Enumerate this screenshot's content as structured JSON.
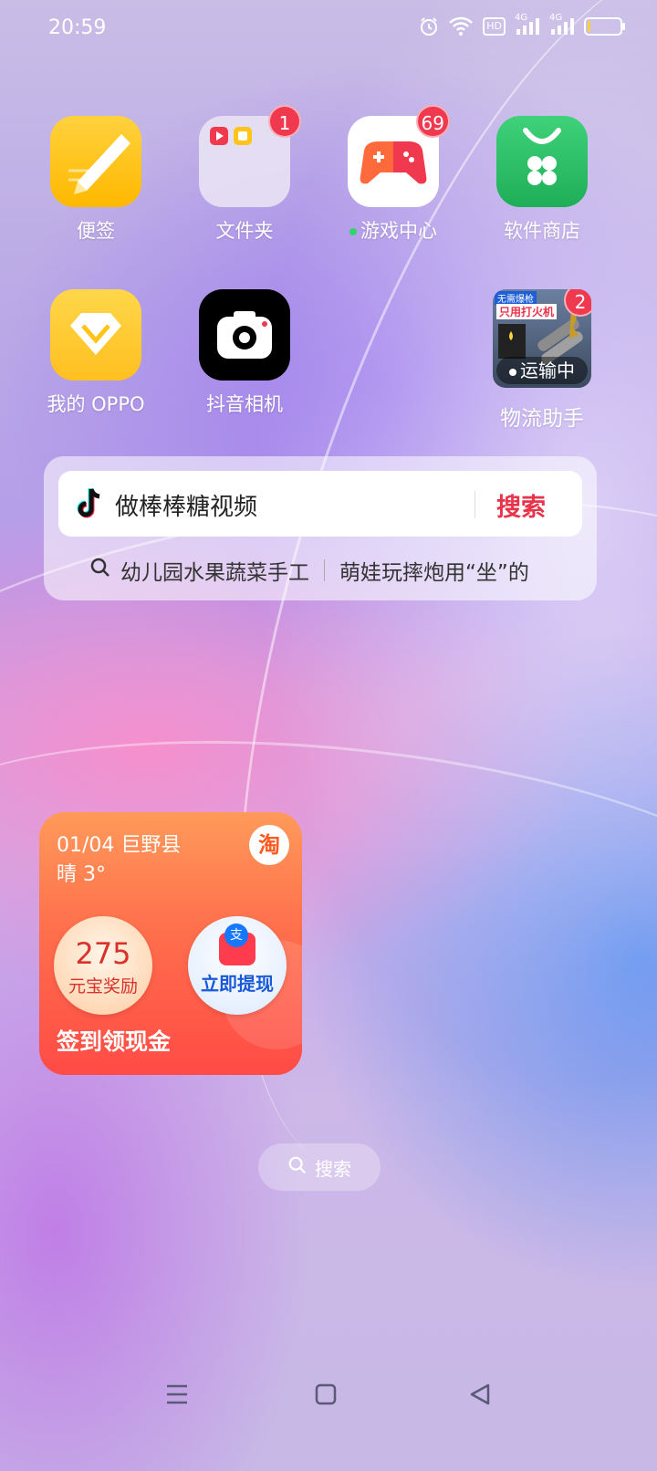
{
  "status_bar": {
    "time": "20:59",
    "icons": [
      "alarm-icon",
      "wifi-icon",
      "hd-icon",
      "signal-4g-icon",
      "signal-4g-icon",
      "battery-icon"
    ],
    "hd_label": "HD",
    "net_label_1": "4G",
    "net_label_2": "4G",
    "battery_level": 0.1,
    "battery_color": "#f7d23a"
  },
  "apps": [
    {
      "label": "便签",
      "icon": "notes-icon"
    },
    {
      "label": "文件夹",
      "icon": "folder-icon",
      "badge": "1"
    },
    {
      "label": "游戏中心",
      "icon": "game-center-icon",
      "badge": "69"
    },
    {
      "label": "软件商店",
      "icon": "app-store-icon"
    },
    {
      "label": "我的 OPPO",
      "icon": "my-oppo-icon"
    },
    {
      "label": "抖音相机",
      "icon": "camera-icon"
    },
    {
      "label": "物流助手",
      "icon": "logistics-icon",
      "badge": "2",
      "overlay": "运输中",
      "thumb_top": "无需爆枪",
      "thumb_sub": "只用打火机"
    }
  ],
  "search_widget": {
    "query": "做棒棒糖视频",
    "button": "搜索",
    "hot_1": "幼儿园水果蔬菜手工",
    "hot_2": "萌娃玩摔炮用“坐”的",
    "accent": "#e8334a"
  },
  "taobao_widget": {
    "date": "01/04 巨野县",
    "weather": "晴 3°",
    "logo": "淘",
    "coin_num": "275",
    "coin_label": "元宝奖励",
    "cash_label": "立即提现",
    "bottom": "签到领现金"
  },
  "home_search": {
    "label": "搜索"
  },
  "nav": {
    "icons": [
      "menu-icon",
      "home-icon",
      "back-icon"
    ]
  }
}
